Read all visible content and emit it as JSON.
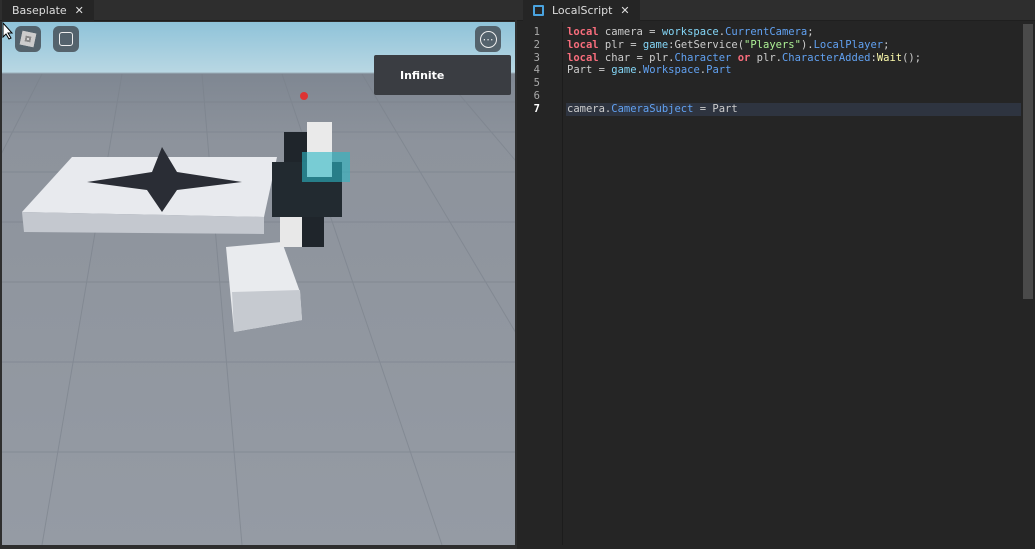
{
  "viewport_tab": {
    "label": "Baseplate",
    "close": "✕"
  },
  "viewport": {
    "roblox_icon": "roblox-logo-icon",
    "chat_icon": "chat-icon",
    "more_icon": "⋯",
    "popup_text": "Infinite"
  },
  "editor_tab": {
    "label": "LocalScript",
    "close": "✕"
  },
  "colors": {
    "keyword": "#f86d7c",
    "builtin": "#84d6f7",
    "property": "#61a1f1",
    "string": "#adf195",
    "method": "#fdfbac",
    "text": "#cccccc"
  },
  "editor": {
    "current_line": 7,
    "lines": [
      [
        {
          "t": "local",
          "c": "keyword"
        },
        {
          "t": " camera = ",
          "c": "text"
        },
        {
          "t": "workspace",
          "c": "builtin"
        },
        {
          "t": ".",
          "c": "text"
        },
        {
          "t": "CurrentCamera",
          "c": "property"
        },
        {
          "t": ";",
          "c": "text"
        }
      ],
      [
        {
          "t": "local",
          "c": "keyword"
        },
        {
          "t": " plr = ",
          "c": "text"
        },
        {
          "t": "game",
          "c": "builtin"
        },
        {
          "t": ":GetService(",
          "c": "text"
        },
        {
          "t": "\"Players\"",
          "c": "string"
        },
        {
          "t": ").",
          "c": "text"
        },
        {
          "t": "LocalPlayer",
          "c": "property"
        },
        {
          "t": ";",
          "c": "text"
        }
      ],
      [
        {
          "t": "local",
          "c": "keyword"
        },
        {
          "t": " char = plr.",
          "c": "text"
        },
        {
          "t": "Character",
          "c": "property"
        },
        {
          "t": " ",
          "c": "text"
        },
        {
          "t": "or",
          "c": "keyword"
        },
        {
          "t": " plr.",
          "c": "text"
        },
        {
          "t": "CharacterAdded",
          "c": "property"
        },
        {
          "t": ":",
          "c": "text"
        },
        {
          "t": "Wait",
          "c": "method"
        },
        {
          "t": "();",
          "c": "text"
        }
      ],
      [
        {
          "t": "Part = ",
          "c": "text"
        },
        {
          "t": "game",
          "c": "builtin"
        },
        {
          "t": ".",
          "c": "text"
        },
        {
          "t": "Workspace",
          "c": "property"
        },
        {
          "t": ".",
          "c": "text"
        },
        {
          "t": "Part",
          "c": "property"
        }
      ],
      [],
      [],
      [
        {
          "t": "camera.",
          "c": "text"
        },
        {
          "t": "CameraSubject",
          "c": "property"
        },
        {
          "t": " = Part",
          "c": "text"
        }
      ]
    ]
  }
}
